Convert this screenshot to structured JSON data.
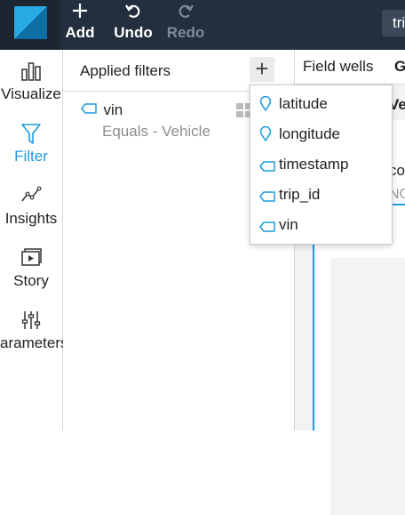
{
  "toolbar": {
    "add_label": "Add",
    "undo_label": "Undo",
    "redo_label": "Redo",
    "analysis_title": "tri"
  },
  "nav": {
    "items": [
      {
        "label": "Visualize",
        "icon": "bar-chart-icon"
      },
      {
        "label": "Filter",
        "icon": "funnel-icon",
        "active": true
      },
      {
        "label": "Insights",
        "icon": "insights-icon"
      },
      {
        "label": "Story",
        "icon": "story-icon"
      },
      {
        "label": "arameters",
        "icon": "sliders-icon"
      }
    ]
  },
  "filters_panel": {
    "title": "Applied filters",
    "add_label": "+",
    "filters": [
      {
        "field": "vin",
        "condition": "Equals - Vehicle"
      }
    ]
  },
  "field_wells": {
    "label": "Field wells",
    "next_label": "G",
    "cut_title": "Vehi",
    "cut_text_1": "co",
    "cut_text_2": "NG"
  },
  "field_menu": {
    "items": [
      {
        "label": "latitude",
        "icon": "geo-pin-icon"
      },
      {
        "label": "longitude",
        "icon": "geo-pin-icon"
      },
      {
        "label": "timestamp",
        "icon": "dimension-tag-icon"
      },
      {
        "label": "trip_id",
        "icon": "dimension-tag-icon"
      },
      {
        "label": "vin",
        "icon": "dimension-tag-icon"
      }
    ]
  },
  "colors": {
    "topbar": "#232f3e",
    "accent": "#1b9cdb",
    "border": "#d5d9dd"
  }
}
